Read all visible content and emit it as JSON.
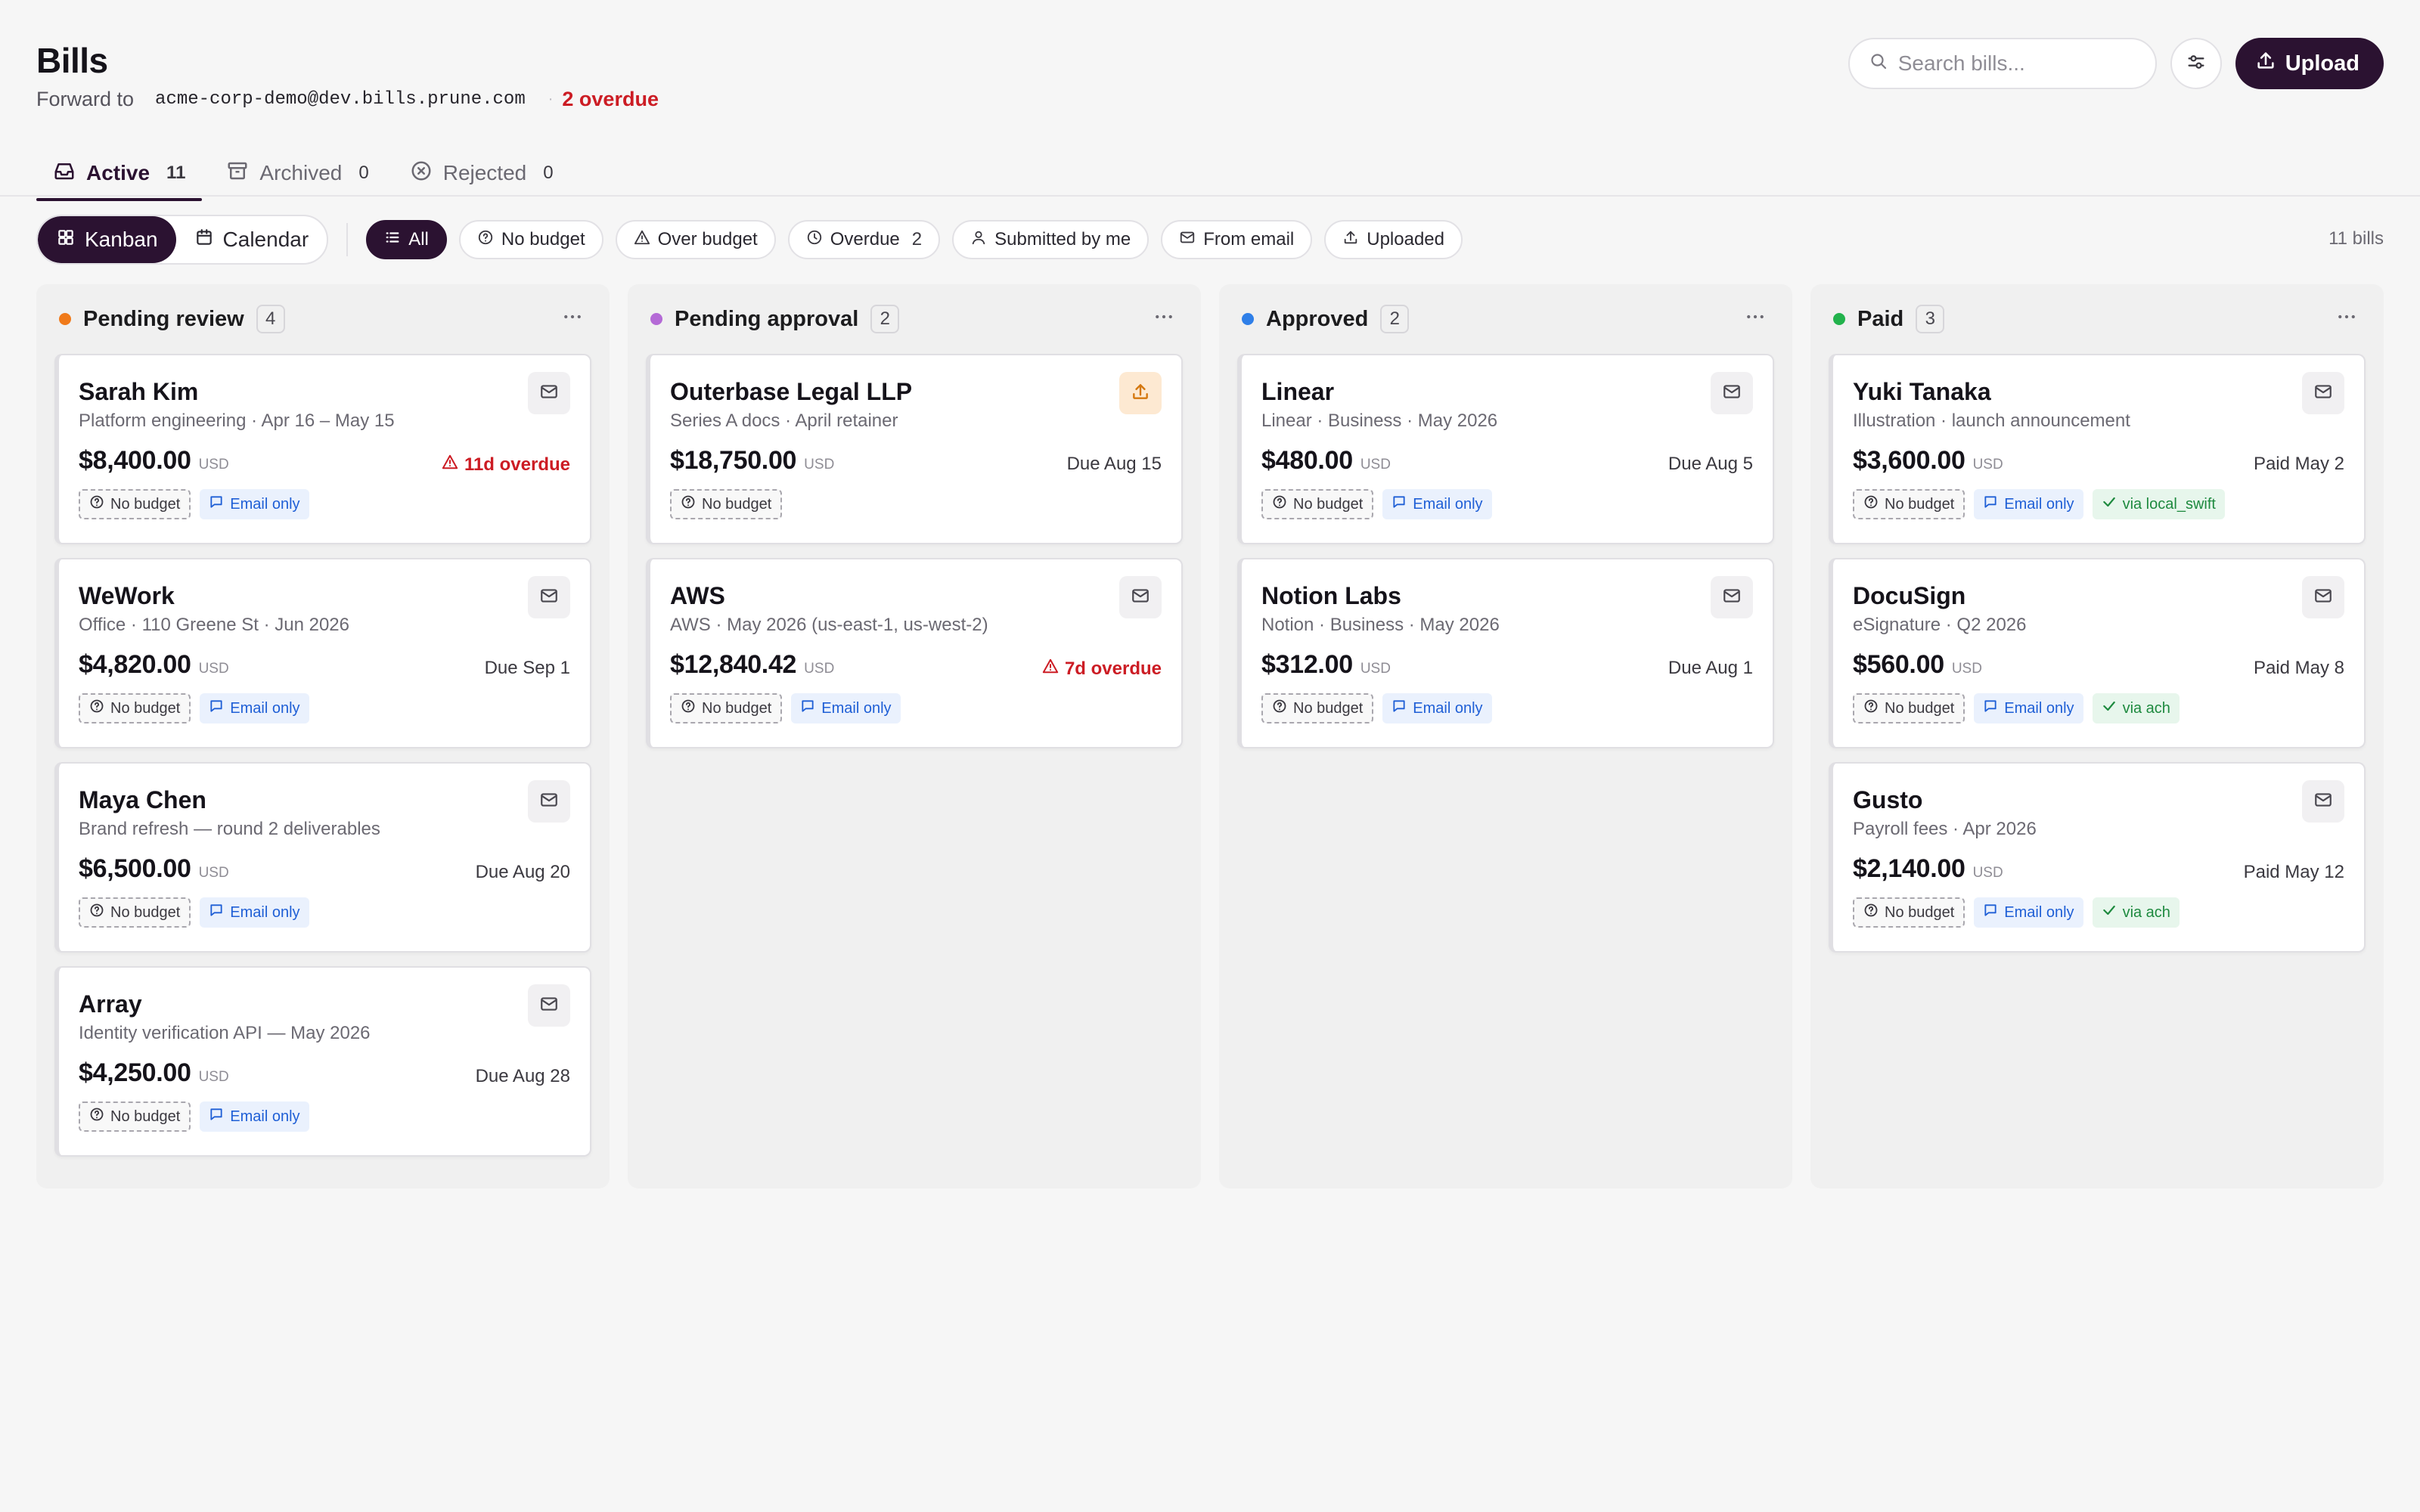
{
  "header": {
    "title": "Bills",
    "forward_label": "Forward to",
    "forward_email": "acme-corp-demo@dev.bills.prune.com",
    "separator": "·",
    "overdue_text": "2 overdue"
  },
  "search": {
    "placeholder": "Search bills..."
  },
  "upload_label": "Upload",
  "tabs": [
    {
      "label": "Active",
      "count": "11",
      "icon": "inbox-icon"
    },
    {
      "label": "Archived",
      "count": "0",
      "icon": "archive-icon"
    },
    {
      "label": "Rejected",
      "count": "0",
      "icon": "x-circle-icon"
    }
  ],
  "views": [
    {
      "label": "Kanban",
      "icon": "grid-icon"
    },
    {
      "label": "Calendar",
      "icon": "calendar-icon"
    }
  ],
  "filters": [
    {
      "label": "All",
      "icon": "list-icon",
      "count": ""
    },
    {
      "label": "No budget",
      "icon": "help-circle-icon",
      "count": ""
    },
    {
      "label": "Over budget",
      "icon": "alert-triangle-icon",
      "count": ""
    },
    {
      "label": "Overdue",
      "icon": "clock-icon",
      "count": "2"
    },
    {
      "label": "Submitted by me",
      "icon": "user-icon",
      "count": ""
    },
    {
      "label": "From email",
      "icon": "mail-icon",
      "count": ""
    },
    {
      "label": "Uploaded",
      "icon": "upload-icon",
      "count": ""
    }
  ],
  "bill_count": "11 bills",
  "colors": {
    "accent": "#2b1231",
    "pending_review": "#f07a1a",
    "pending_approval": "#b46ad6",
    "approved": "#2f7fe8",
    "paid": "#22b24c",
    "overdue": "#cc1c24"
  },
  "columns": [
    {
      "title": "Pending review",
      "count": "4",
      "cards": [
        {
          "name": "Sarah Kim",
          "desc": "Platform engineering · Apr 16 – May 15",
          "amount": "$8,400.00",
          "currency": "USD",
          "right": "11d overdue",
          "overdue": true,
          "source": "mail-icon",
          "tags": [
            "No budget",
            "Email only"
          ]
        },
        {
          "name": "WeWork",
          "desc": "Office · 110 Greene St · Jun 2026",
          "amount": "$4,820.00",
          "currency": "USD",
          "right": "Due Sep 1",
          "overdue": false,
          "source": "mail-icon",
          "tags": [
            "No budget",
            "Email only"
          ]
        },
        {
          "name": "Maya Chen",
          "desc": "Brand refresh — round 2 deliverables",
          "amount": "$6,500.00",
          "currency": "USD",
          "right": "Due Aug 20",
          "overdue": false,
          "source": "mail-icon",
          "tags": [
            "No budget",
            "Email only"
          ]
        },
        {
          "name": "Array",
          "desc": "Identity verification API — May 2026",
          "amount": "$4,250.00",
          "currency": "USD",
          "right": "Due Aug 28",
          "overdue": false,
          "source": "mail-icon",
          "tags": [
            "No budget",
            "Email only"
          ]
        }
      ]
    },
    {
      "title": "Pending approval",
      "count": "2",
      "cards": [
        {
          "name": "Outerbase Legal LLP",
          "desc": "Series A docs · April retainer",
          "amount": "$18,750.00",
          "currency": "USD",
          "right": "Due Aug 15",
          "overdue": false,
          "source": "upload-icon",
          "tags": [
            "No budget"
          ]
        },
        {
          "name": "AWS",
          "desc": "AWS · May 2026 (us-east-1, us-west-2)",
          "amount": "$12,840.42",
          "currency": "USD",
          "right": "7d overdue",
          "overdue": true,
          "source": "mail-icon",
          "tags": [
            "No budget",
            "Email only"
          ]
        }
      ]
    },
    {
      "title": "Approved",
      "count": "2",
      "cards": [
        {
          "name": "Linear",
          "desc": "Linear · Business · May 2026",
          "amount": "$480.00",
          "currency": "USD",
          "right": "Due Aug 5",
          "overdue": false,
          "source": "mail-icon",
          "tags": [
            "No budget",
            "Email only"
          ]
        },
        {
          "name": "Notion Labs",
          "desc": "Notion · Business · May 2026",
          "amount": "$312.00",
          "currency": "USD",
          "right": "Due Aug 1",
          "overdue": false,
          "source": "mail-icon",
          "tags": [
            "No budget",
            "Email only"
          ]
        }
      ]
    },
    {
      "title": "Paid",
      "count": "3",
      "cards": [
        {
          "name": "Yuki Tanaka",
          "desc": "Illustration · launch announcement",
          "amount": "$3,600.00",
          "currency": "USD",
          "right": "Paid May 2",
          "overdue": false,
          "source": "mail-icon",
          "tags": [
            "No budget",
            "Email only",
            "via local_swift"
          ]
        },
        {
          "name": "DocuSign",
          "desc": "eSignature · Q2 2026",
          "amount": "$560.00",
          "currency": "USD",
          "right": "Paid May 8",
          "overdue": false,
          "source": "mail-icon",
          "tags": [
            "No budget",
            "Email only",
            "via ach"
          ]
        },
        {
          "name": "Gusto",
          "desc": "Payroll fees · Apr 2026",
          "amount": "$2,140.00",
          "currency": "USD",
          "right": "Paid May 12",
          "overdue": false,
          "source": "mail-icon",
          "tags": [
            "No budget",
            "Email only",
            "via ach"
          ]
        }
      ]
    }
  ]
}
